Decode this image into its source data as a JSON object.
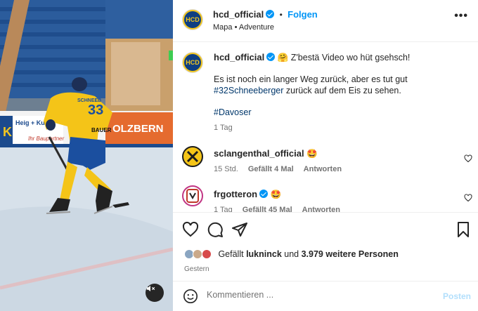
{
  "media": {
    "jersey_number": "33",
    "jersey_name": "SCHNEEB",
    "sponsor": "BAUER",
    "board_left": "Heig + Kuml",
    "board_left2": "Ihr Baupartner",
    "board_right": "OLZBERN"
  },
  "header": {
    "logo_text": "HCD",
    "username": "hcd_official",
    "follow_label": "Folgen",
    "separator": "•",
    "subtitle": "Mapa • Adventure",
    "more_label": "•••"
  },
  "caption": {
    "username": "hcd_official",
    "emoji": "🤗",
    "line1": " Z'bestä Video wo hüt gsehsch!",
    "line2": "Es ist noch ein langer Weg zurück, aber es tut gut",
    "hashtag1": "#32Schneeberger",
    "line3": " zurück auf dem Eis zu sehen.",
    "hashtag2": "#Davoser",
    "time": "1 Tag"
  },
  "comments": [
    {
      "username": "sclangenthal_official",
      "text": "🤩",
      "time": "15 Std.",
      "likes": "Gefällt 4 Mal",
      "reply": "Antworten"
    },
    {
      "username": "frgotteron",
      "text": "🤩",
      "time": "1 Tag",
      "likes": "Gefällt 45 Mal",
      "reply": "Antworten"
    }
  ],
  "actions": {
    "likes_prefix": "Gefällt ",
    "liked_by": "lukninck",
    "likes_middle": " und ",
    "likes_count": "3.979 weitere Personen",
    "date": "Gestern"
  },
  "comment_box": {
    "placeholder": "Kommentieren ...",
    "post_label": "Posten"
  },
  "colors": {
    "accent": "#0095f6",
    "hashtag": "#00376b",
    "hcd_yellow": "#f2c61f",
    "hcd_blue": "#0e3f82"
  }
}
